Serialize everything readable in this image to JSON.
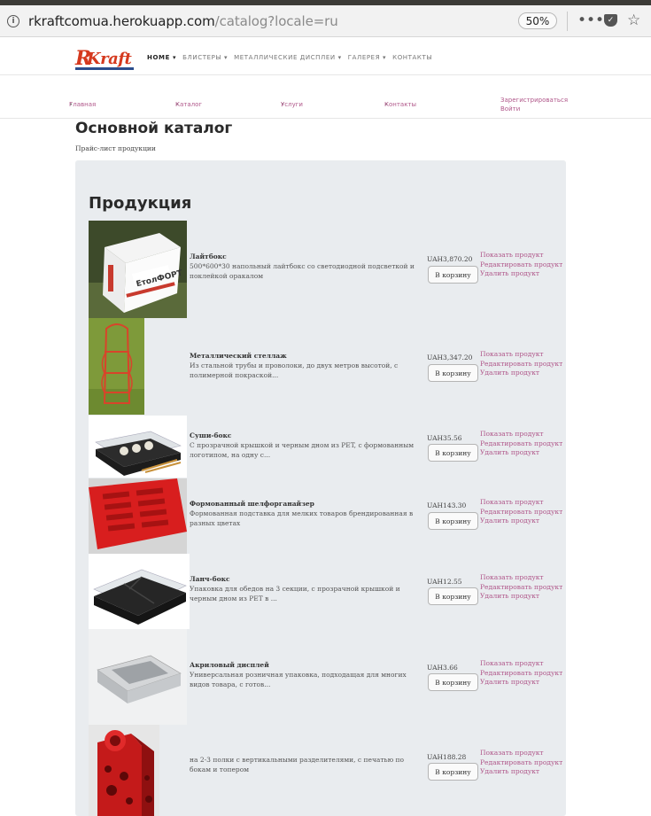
{
  "browser": {
    "url_domain": "rkraftcomua.herokuapp.com",
    "url_path": "/catalog?locale=ru",
    "zoom": "50%"
  },
  "logo": {
    "first": "R",
    "rest": "Kraft"
  },
  "main_nav": [
    {
      "label": "HOME ▾",
      "active": true
    },
    {
      "label": "БЛИСТЕРЫ ▾"
    },
    {
      "label": "МЕТАЛЛИЧЕСКИЕ ДИСПЛЕИ ▾"
    },
    {
      "label": "ГАЛЕРЕЯ ▾"
    },
    {
      "label": "КОНТАКТЫ"
    }
  ],
  "sub_nav": {
    "home": "Главная",
    "catalog": "Каталог",
    "services": "Услуги",
    "contacts": "Контакты",
    "register": "Зарегистрироваться",
    "login": "Войти"
  },
  "page": {
    "title": "Основной каталог",
    "subtitle": "Прайс-лист продукции",
    "section_title": "Продукция"
  },
  "labels": {
    "cart": "В корзину",
    "show": "Показать продукт",
    "edit": "Редактировать продукт",
    "delete": "Удалить продукт"
  },
  "products": [
    {
      "name": "Лайтбокс",
      "desc": "500*600*30 напольный лайтбокс со светодиодной подсветкой и поклейкой оракалом",
      "price": "UAH3,870.20",
      "image": "lightbox-photo"
    },
    {
      "name": "Металлический стеллаж",
      "desc": "Из стальной трубы и проволоки, до двух метров высотой, с полимерной покраской...",
      "price": "UAH3,347.20",
      "image": "metal-rack-photo"
    },
    {
      "name": "Суши-бокс",
      "desc": "С прозрачной крышкой и черным дном из PET, с формованным логотипом, на одну с...",
      "price": "UAH35.56",
      "image": "sushi-box-photo"
    },
    {
      "name": "Формованный шелфорганайзер",
      "desc": "Формованная подставка для мелких товаров брендированная в разных цветах",
      "price": "UAH143.30",
      "image": "shelf-organizer-photo"
    },
    {
      "name": "Ланч-бокс",
      "desc": "Упаковка для обедов на 3 секции, с прозрачной крышкой и черным дном из PET в ...",
      "price": "UAH12.55",
      "image": "lunch-box-photo"
    },
    {
      "name": "Акриловый дисплей",
      "desc": "Универсальная розничная упаковка, подходащая для многих видов товара, с готов...",
      "price": "UAH3.66",
      "image": "acrylic-display-photo"
    },
    {
      "name": "",
      "desc": "на 2-3 полки с вертикальными разделителями, с печатью по бокам и топером",
      "price": "UAH188.28",
      "image": "cardboard-display-photo"
    }
  ]
}
